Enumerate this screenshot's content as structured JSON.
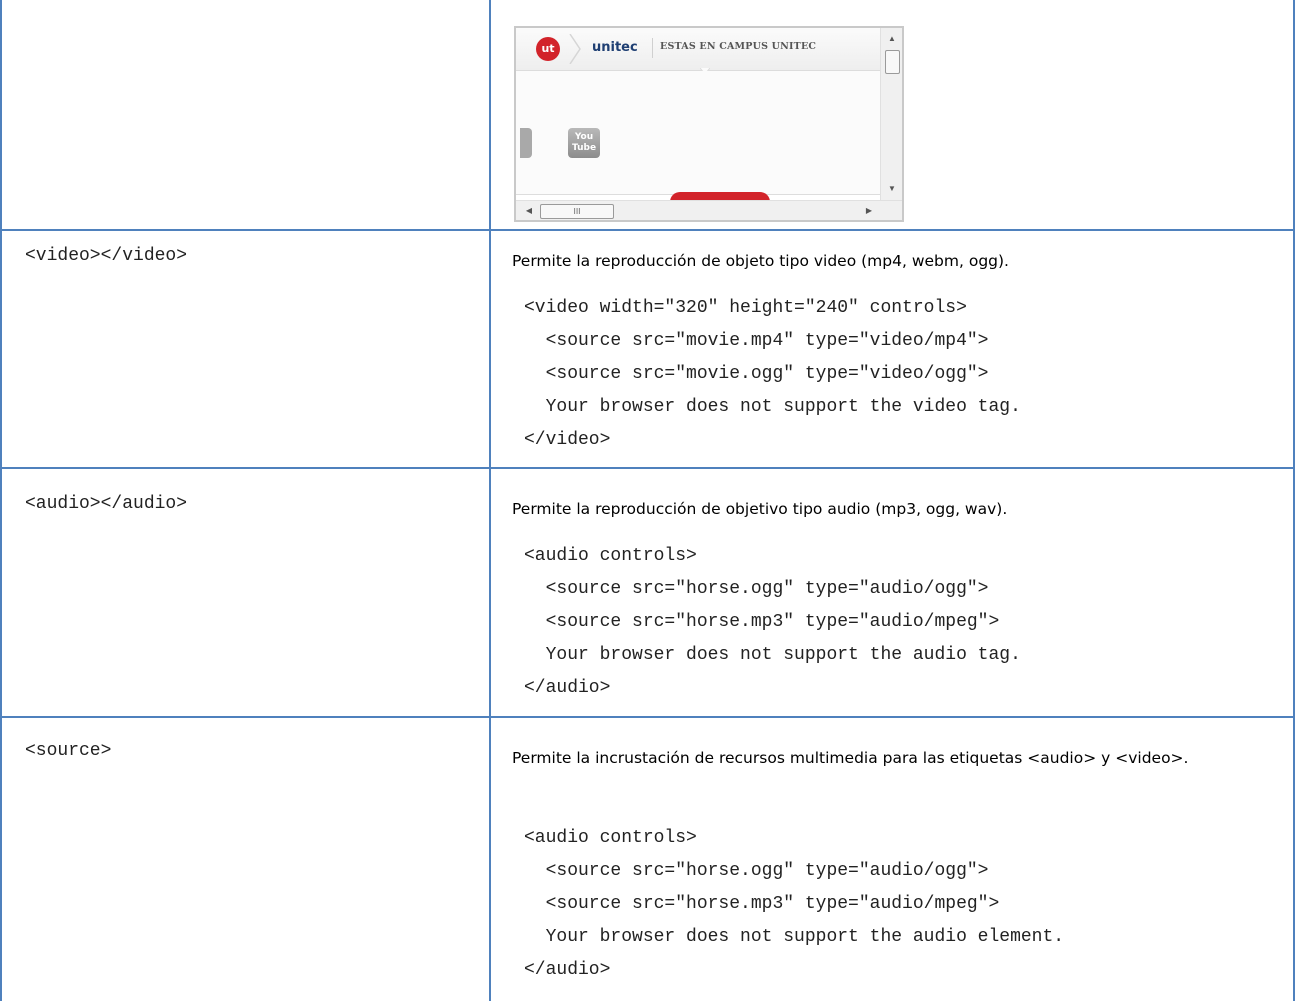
{
  "colors": {
    "table_border": "#4f81bd",
    "brand_red": "#d2232a",
    "brand_blue": "#1f3f73"
  },
  "screenshot": {
    "logo_text": "ut",
    "brand": "unitec",
    "header_text": "ESTAS EN CAMPUS UNITEC",
    "youtube_line1": "You",
    "youtube_line2": "Tube",
    "scrollbar_grip": "III"
  },
  "rows": [
    {
      "tag": "<video></video>",
      "description": "Permite la reproducción de objeto tipo video (mp4, webm, ogg).",
      "code": "<video width=\"320\" height=\"240\" controls>\n  <source src=\"movie.mp4\" type=\"video/mp4\">\n  <source src=\"movie.ogg\" type=\"video/ogg\">\n  Your browser does not support the video tag.\n</video>"
    },
    {
      "tag": "<audio></audio>",
      "description": "Permite la reproducción de objetivo tipo audio (mp3, ogg, wav).",
      "code": "<audio controls>\n  <source src=\"horse.ogg\" type=\"audio/ogg\">\n  <source src=\"horse.mp3\" type=\"audio/mpeg\">\n  Your browser does not support the audio tag.\n</audio>"
    },
    {
      "tag": "<source>",
      "description": "Permite la incrustación de recursos multimedia para las etiquetas <audio> y <video>.",
      "code": "<audio controls>\n  <source src=\"horse.ogg\" type=\"audio/ogg\">\n  <source src=\"horse.mp3\" type=\"audio/mpeg\">\n  Your browser does not support the audio element.\n</audio>"
    }
  ]
}
